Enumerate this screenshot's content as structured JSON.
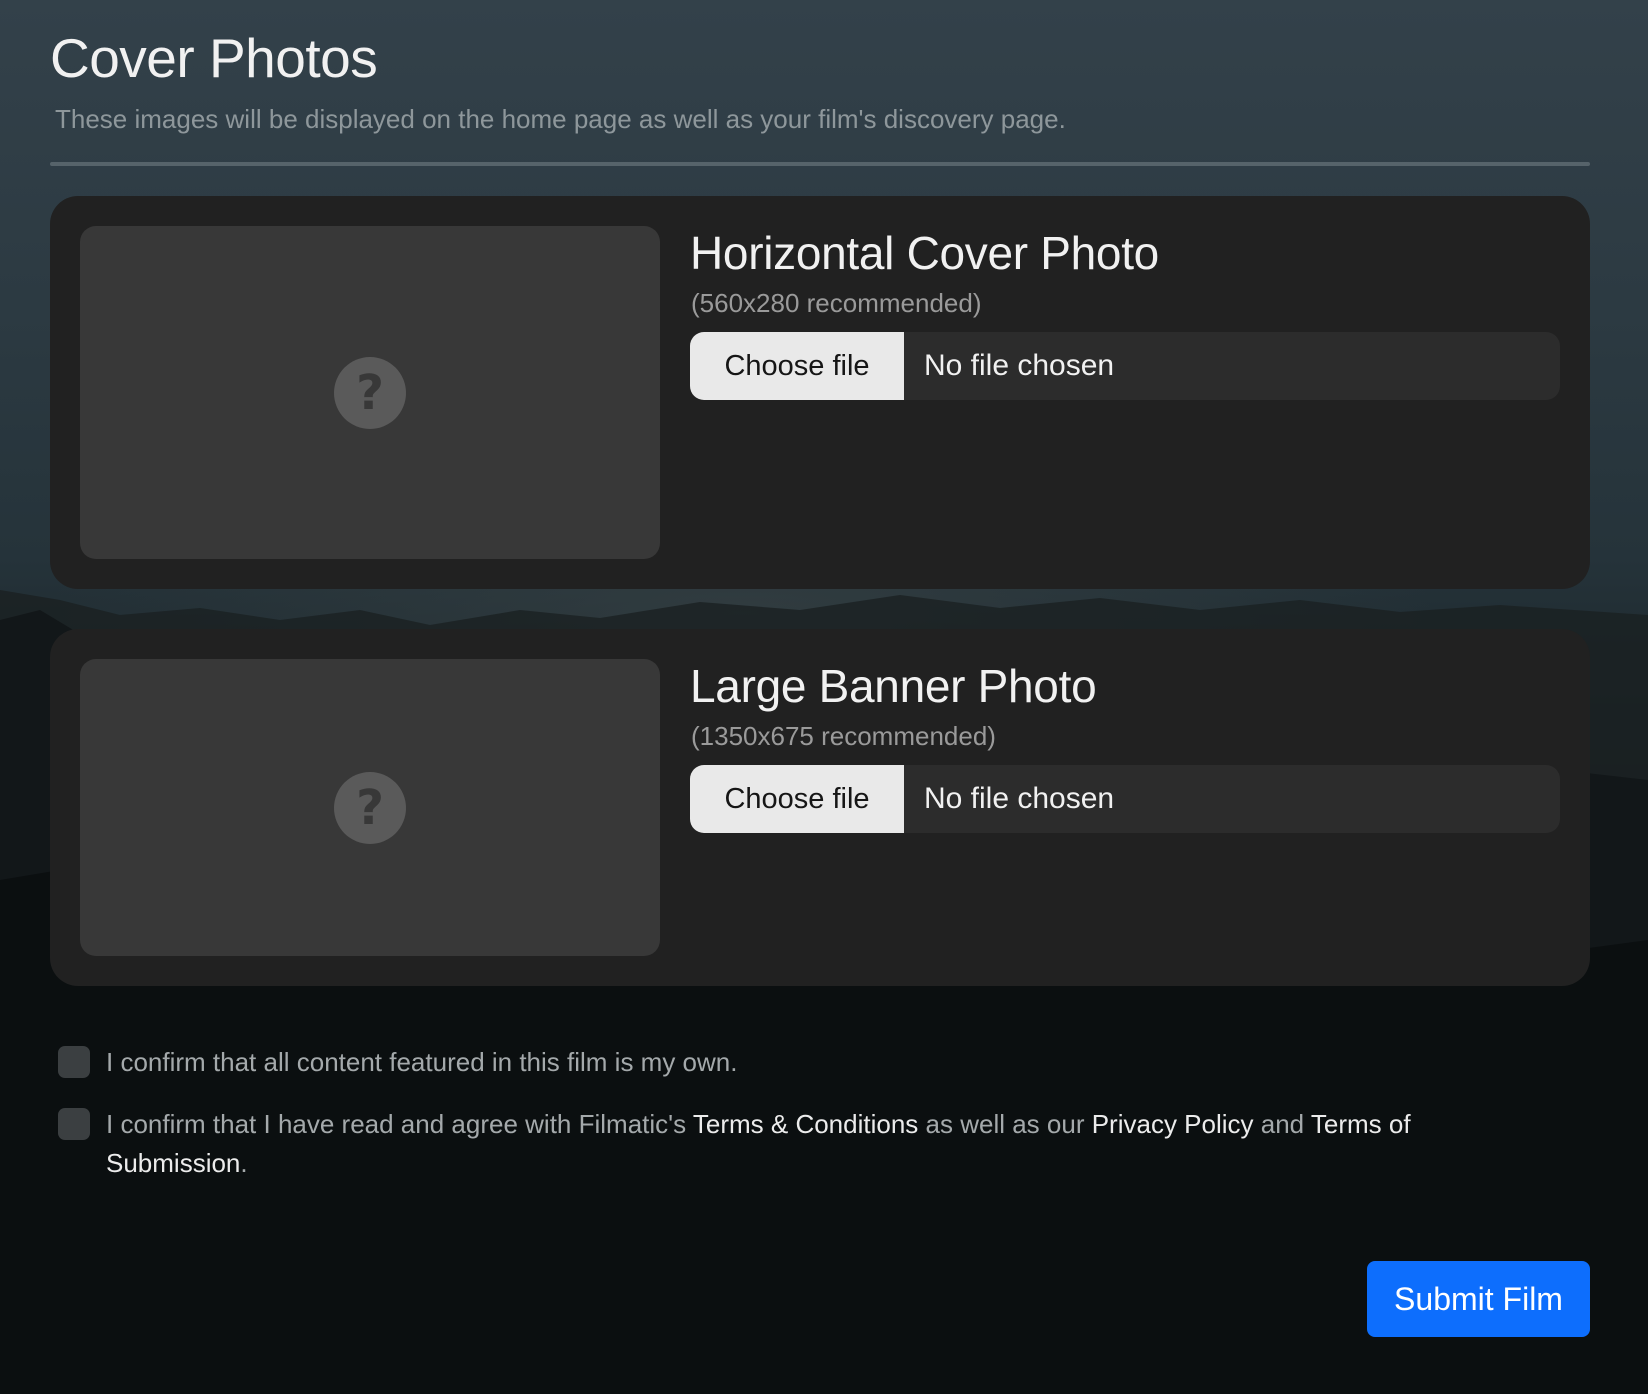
{
  "header": {
    "title": "Cover Photos",
    "subtitle": "These images will be displayed on the home page as well as your film's discovery page."
  },
  "cards": [
    {
      "title": "Horizontal Cover Photo",
      "recommendation": "(560x280 recommended)",
      "choose_label": "Choose file",
      "file_status": "No file chosen",
      "placeholder_icon": "question-mark-icon"
    },
    {
      "title": "Large Banner Photo",
      "recommendation": "(1350x675 recommended)",
      "choose_label": "Choose file",
      "file_status": "No file chosen",
      "placeholder_icon": "question-mark-icon"
    }
  ],
  "placeholder_glyph": "?",
  "confirmations": {
    "own_content": {
      "checked": false,
      "text": "I confirm that all content featured in this film is my own."
    },
    "terms": {
      "checked": false,
      "text_1": "I confirm that I have read and agree with Filmatic's ",
      "link_terms": "Terms & Conditions",
      "text_2": " as well as our ",
      "link_privacy": "Privacy Policy",
      "text_3": " and ",
      "link_submission": "Terms of Submission",
      "text_4": "."
    }
  },
  "submit": {
    "label": "Submit Film"
  },
  "colors": {
    "accent": "#0d6efd",
    "card": "#212121",
    "preview": "#383838"
  }
}
